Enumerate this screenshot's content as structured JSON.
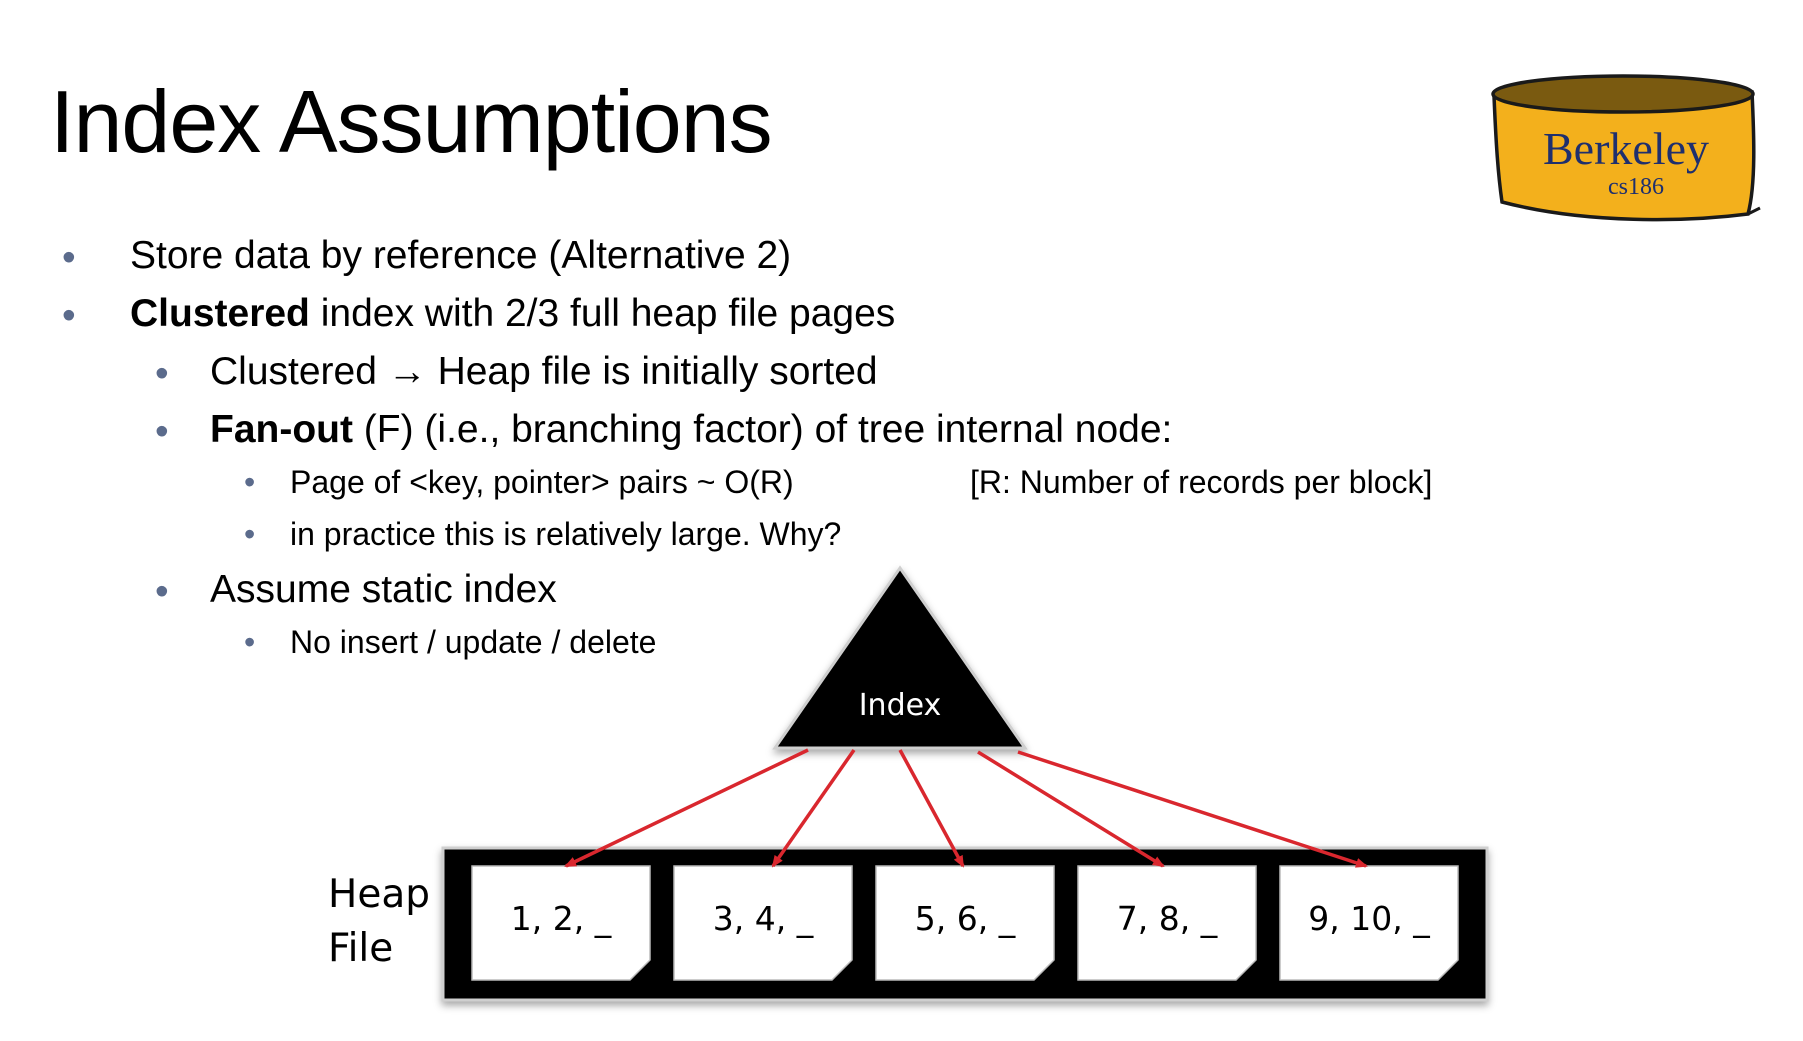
{
  "title": "Index Assumptions",
  "logo": {
    "name": "Berkeley",
    "course": "cs186"
  },
  "bullets": {
    "b1": {
      "text": "Store data by reference (Alternative 2)"
    },
    "b2": {
      "bold": "Clustered",
      "rest": " index with 2/3 full heap file pages"
    },
    "b2a": {
      "text": "Clustered → Heap file is initially sorted"
    },
    "b2b": {
      "bold": "Fan-out",
      "rest": " (F) (i.e., branching factor) of tree internal node:"
    },
    "b2b1": {
      "text": "Page of <key, pointer> pairs ~ O(R)"
    },
    "b2b1_note": "[R: Number of records per block]",
    "b2b2": {
      "text": "in practice this is relatively large. Why?"
    },
    "b2c": {
      "text": "Assume static index"
    },
    "b2c1": {
      "text": "No insert / update / delete"
    }
  },
  "diagram": {
    "index_label": "Index",
    "heap_label_line1": "Heap",
    "heap_label_line2": "File",
    "pages": [
      "1, 2, _",
      "3, 4, _",
      "5, 6, _",
      "7, 8, _",
      "9, 10, _"
    ],
    "arrow_color": "#d9272e"
  }
}
